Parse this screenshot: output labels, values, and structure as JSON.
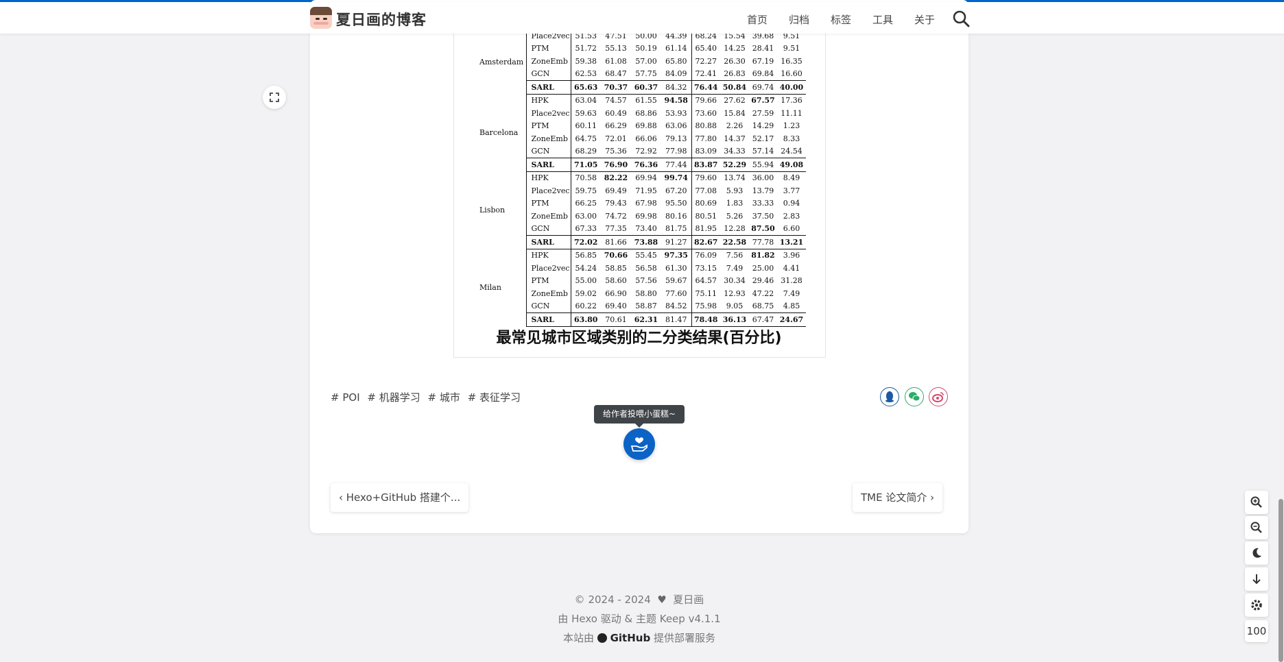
{
  "site": {
    "title": "夏日画的博客"
  },
  "nav": {
    "items": [
      "首页",
      "归档",
      "标签",
      "工具",
      "关于"
    ]
  },
  "table": {
    "groups": [
      {
        "city": "Amsterdam",
        "rows": [
          {
            "model": "Place2vec",
            "values": [
              "51.53",
              "47.51",
              "50.00",
              "44.39",
              "68.24",
              "15.54",
              "39.68",
              "9.51"
            ]
          },
          {
            "model": "PTM",
            "values": [
              "51.72",
              "55.13",
              "50.19",
              "61.14",
              "65.40",
              "14.25",
              "28.41",
              "9.51"
            ]
          },
          {
            "model": "ZoneEmb",
            "values": [
              "59.38",
              "61.08",
              "57.00",
              "65.80",
              "72.27",
              "26.30",
              "67.19",
              "16.35"
            ]
          },
          {
            "model": "GCN",
            "values": [
              "62.53",
              "68.47",
              "57.75",
              "84.09",
              "72.41",
              "26.83",
              "69.84",
              "16.60"
            ]
          },
          {
            "model": "SARL",
            "values": [
              "65.63",
              "70.37",
              "60.37",
              "84.32",
              "76.44",
              "50.84",
              "69.74",
              "40.00"
            ],
            "bold": [
              0,
              1,
              2,
              4,
              5,
              7
            ]
          }
        ]
      },
      {
        "city": "Barcelona",
        "rows": [
          {
            "model": "HPK",
            "values": [
              "63.04",
              "74.57",
              "61.55",
              "94.58",
              "79.66",
              "27.62",
              "67.57",
              "17.36"
            ],
            "bold": [
              3,
              6
            ]
          },
          {
            "model": "Place2vec",
            "values": [
              "59.63",
              "60.49",
              "68.86",
              "53.93",
              "73.60",
              "15.84",
              "27.59",
              "11.11"
            ]
          },
          {
            "model": "PTM",
            "values": [
              "60.11",
              "66.29",
              "69.88",
              "63.06",
              "80.88",
              "2.26",
              "14.29",
              "1.23"
            ]
          },
          {
            "model": "ZoneEmb",
            "values": [
              "64.75",
              "72.01",
              "66.06",
              "79.13",
              "77.80",
              "14.37",
              "52.17",
              "8.33"
            ]
          },
          {
            "model": "GCN",
            "values": [
              "68.29",
              "75.36",
              "72.92",
              "77.98",
              "83.09",
              "34.33",
              "57.14",
              "24.54"
            ]
          },
          {
            "model": "SARL",
            "values": [
              "71.05",
              "76.90",
              "76.36",
              "77.44",
              "83.87",
              "52.29",
              "55.94",
              "49.08"
            ],
            "bold": [
              0,
              1,
              2,
              4,
              5,
              7
            ]
          }
        ]
      },
      {
        "city": "Lisbon",
        "rows": [
          {
            "model": "HPK",
            "values": [
              "70.58",
              "82.22",
              "69.94",
              "99.74",
              "79.60",
              "13.74",
              "36.00",
              "8.49"
            ],
            "bold": [
              1,
              3
            ]
          },
          {
            "model": "Place2vec",
            "values": [
              "59.75",
              "69.49",
              "71.95",
              "67.20",
              "77.08",
              "5.93",
              "13.79",
              "3.77"
            ]
          },
          {
            "model": "PTM",
            "values": [
              "66.25",
              "79.43",
              "67.98",
              "95.50",
              "80.69",
              "1.83",
              "33.33",
              "0.94"
            ]
          },
          {
            "model": "ZoneEmb",
            "values": [
              "63.00",
              "74.72",
              "69.98",
              "80.16",
              "80.51",
              "5.26",
              "37.50",
              "2.83"
            ]
          },
          {
            "model": "GCN",
            "values": [
              "67.33",
              "77.35",
              "73.40",
              "81.75",
              "81.95",
              "12.28",
              "87.50",
              "6.60"
            ],
            "bold": [
              6
            ]
          },
          {
            "model": "SARL",
            "values": [
              "72.02",
              "81.66",
              "73.88",
              "91.27",
              "82.67",
              "22.58",
              "77.78",
              "13.21"
            ],
            "bold": [
              0,
              2,
              4,
              5,
              7
            ]
          }
        ]
      },
      {
        "city": "Milan",
        "rows": [
          {
            "model": "HPK",
            "values": [
              "56.85",
              "70.66",
              "55.45",
              "97.35",
              "76.09",
              "7.56",
              "81.82",
              "3.96"
            ],
            "bold": [
              1,
              3,
              6
            ]
          },
          {
            "model": "Place2vec",
            "values": [
              "54.24",
              "58.85",
              "56.58",
              "61.30",
              "73.15",
              "7.49",
              "25.00",
              "4.41"
            ]
          },
          {
            "model": "PTM",
            "values": [
              "55.00",
              "58.60",
              "57.56",
              "59.67",
              "64.57",
              "30.34",
              "29.46",
              "31.28"
            ]
          },
          {
            "model": "ZoneEmb",
            "values": [
              "59.02",
              "66.90",
              "58.80",
              "77.60",
              "75.11",
              "12.93",
              "47.22",
              "7.49"
            ]
          },
          {
            "model": "GCN",
            "values": [
              "60.22",
              "69.40",
              "58.87",
              "84.52",
              "75.98",
              "9.05",
              "68.75",
              "4.85"
            ]
          },
          {
            "model": "SARL",
            "values": [
              "63.80",
              "70.61",
              "62.31",
              "81.47",
              "78.48",
              "36.13",
              "67.47",
              "24.67"
            ],
            "bold": [
              0,
              2,
              4,
              5,
              7
            ]
          }
        ]
      }
    ],
    "caption": "最常见城市区域类别的二分类结果(百分比)"
  },
  "tags": [
    "POI",
    "机器学习",
    "城市",
    "表征学习"
  ],
  "share": {
    "qq_color": "#1e5aa0",
    "wechat_color": "#2aae67",
    "weibo_color": "#d6496a"
  },
  "donate": {
    "tooltip": "给作者投喂小蛋糕~"
  },
  "pager": {
    "prev": "Hexo+GitHub 搭建个...",
    "next": "TME 论文简介"
  },
  "footer": {
    "copyright": "© 2024 - 2024",
    "author": "夏日画",
    "powered": "由 Hexo 驱动 & 主题 Keep v4.1.1",
    "deploy_prefix": "本站由",
    "deploy_brand": "GitHub",
    "deploy_suffix": "提供部署服务"
  },
  "tools": {
    "font_percent": "100"
  },
  "colors": {
    "accent": "#0066cc",
    "donate": "#0b63c6"
  }
}
